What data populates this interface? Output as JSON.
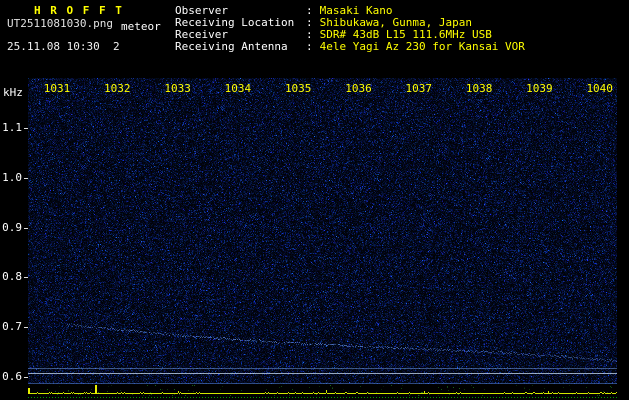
{
  "app": {
    "title": "H R O F F T",
    "filename": "UT2511081030.png",
    "mode_label": "meteor",
    "datetime": "25.11.08 10:30  2"
  },
  "header": {
    "colon": ":",
    "fields": [
      {
        "label": "Observer",
        "value": "Masaki Kano"
      },
      {
        "label": "Receiving Location",
        "value": "Shibukawa, Gunma, Japan"
      },
      {
        "label": "Receiver",
        "value": "SDR# 43dB L15 111.6MHz USB"
      },
      {
        "label": "Receiving Antenna",
        "value": "4ele Yagi Az 230 for Kansai VOR"
      }
    ]
  },
  "colors": {
    "title_yellow": "#ffff00",
    "value_yellow": "#ffff00",
    "label_white": "#ffffff",
    "noise_blue": "#2040c0",
    "trace_cyan": "#6ea0ff",
    "reference_line_cyan": "#d7ebff",
    "level_line_yellow_green": "#d2e600",
    "level_dots_green": "#009900"
  },
  "chart_data": {
    "type": "heatmap",
    "ylabel": "kHz",
    "xlabel": "",
    "ylim": [
      0.6,
      1.2
    ],
    "x_ticks": [
      "1031",
      "1032",
      "1033",
      "1034",
      "1035",
      "1036",
      "1037",
      "1038",
      "1039",
      "1040"
    ],
    "y_ticks": [
      "1.1",
      "1.0",
      "0.9",
      "0.8",
      "0.7",
      "0.6"
    ],
    "grid": false,
    "legend": false,
    "background": "dark blue radio noise speckle field",
    "features": [
      {
        "name": "carrier-drift-trace",
        "kind": "faint descending trace",
        "points": [
          {
            "x": "1031",
            "y_khz": 0.7
          },
          {
            "x": "1035",
            "y_khz": 0.665
          },
          {
            "x": "1040",
            "y_khz": 0.63
          }
        ]
      },
      {
        "name": "reference-line-upper",
        "kind": "horizontal line",
        "y_khz": 0.616
      },
      {
        "name": "reference-line-lower",
        "kind": "horizontal line",
        "y_khz": 0.608
      }
    ],
    "level_meter": {
      "baseline": "dotted green line",
      "trace": "continuous yellow-green signal level line",
      "spike_x": "1032"
    }
  }
}
